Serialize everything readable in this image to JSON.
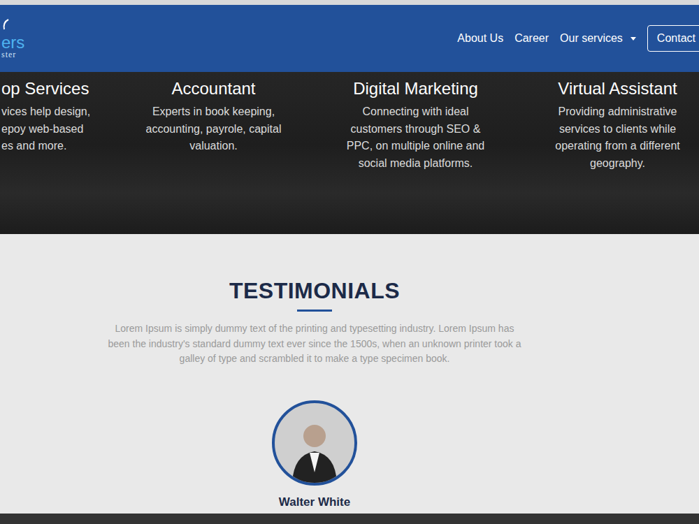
{
  "nav": {
    "logo": {
      "primary": "ers",
      "secondary": "ster"
    },
    "links": [
      {
        "label": "About Us"
      },
      {
        "label": "Career"
      },
      {
        "label": "Our services",
        "kind": "dropdown"
      }
    ],
    "contact": "Contact"
  },
  "services": [
    {
      "title": "op Services",
      "lines": [
        "vices help design,",
        "epoy web-based",
        "es and more."
      ]
    },
    {
      "title": "Accountant",
      "lines": [
        "Experts in book keeping,",
        "accounting, payrole, capital",
        "valuation."
      ]
    },
    {
      "title": "Digital Marketing",
      "lines": [
        "Connecting with ideal",
        "customers through SEO &",
        "PPC, on multiple online and",
        "social media platforms."
      ]
    },
    {
      "title": "Virtual Assistant",
      "lines": [
        "Providing administrative",
        "services to clients while",
        "operating from a different",
        "geography."
      ]
    }
  ],
  "testimonials": {
    "title": "TESTIMONIALS",
    "intro": [
      "Lorem Ipsum is simply dummy text of the printing and typesetting industry. Lorem Ipsum has",
      "been the industry's standard dummy text ever since the 1500s, when an unknown printer took a",
      "galley of type and scrambled it to make a type specimen book."
    ],
    "people": [
      {
        "name": "Walter White"
      }
    ]
  }
}
